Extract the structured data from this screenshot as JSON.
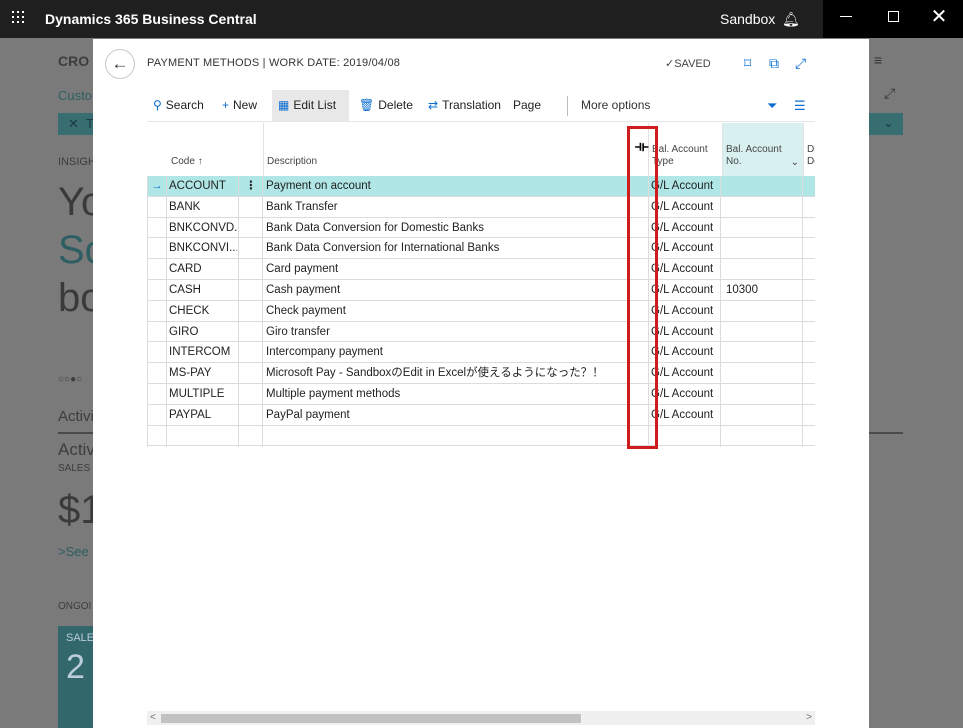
{
  "topbar": {
    "app_title": "Dynamics 365 Business Central",
    "environment": "Sandbox",
    "bell_icon": "bell-icon"
  },
  "background": {
    "company_short": "CRO",
    "customers_short": "Custo",
    "filter_short": "T",
    "insights_short": "INSIGH",
    "big1": "Yo",
    "big2": "Sc",
    "big3": "bo",
    "activities": "Activi",
    "activities2": "Activ",
    "sales_label": "SALES",
    "amount_short": "$1",
    "see_more": "See",
    "ongoing": "ONGOI",
    "card_label": "SALE",
    "card_number": "2"
  },
  "dialog": {
    "title": "PAYMENT METHODS | WORK DATE: 2019/04/08",
    "saved_label": "SAVED"
  },
  "actions": {
    "search": "Search",
    "new": "New",
    "edit_list": "Edit List",
    "delete": "Delete",
    "translation": "Translation",
    "page": "Page",
    "more_options": "More options"
  },
  "grid": {
    "columns": {
      "code": "Code",
      "description": "Description",
      "bal_account_type_1": "Bal. Account",
      "bal_account_type_2": "Type",
      "bal_account_no_1": "Bal. Account",
      "bal_account_no_2": "No.",
      "next_col_1": "Di",
      "next_col_2": "De"
    },
    "rows": [
      {
        "code": "ACCOUNT",
        "description": "Payment on account",
        "type": "G/L Account",
        "no": ""
      },
      {
        "code": "BANK",
        "description": "Bank Transfer",
        "type": "G/L Account",
        "no": ""
      },
      {
        "code": "BNKCONVD...",
        "description": "Bank Data Conversion for Domestic Banks",
        "type": "G/L Account",
        "no": ""
      },
      {
        "code": "BNKCONVI...",
        "description": "Bank Data Conversion for International Banks",
        "type": "G/L Account",
        "no": ""
      },
      {
        "code": "CARD",
        "description": "Card payment",
        "type": "G/L Account",
        "no": ""
      },
      {
        "code": "CASH",
        "description": "Cash payment",
        "type": "G/L Account",
        "no": "10300"
      },
      {
        "code": "CHECK",
        "description": "Check payment",
        "type": "G/L Account",
        "no": ""
      },
      {
        "code": "GIRO",
        "description": "Giro transfer",
        "type": "G/L Account",
        "no": ""
      },
      {
        "code": "INTERCOM",
        "description": "Intercompany payment",
        "type": "G/L Account",
        "no": ""
      },
      {
        "code": "MS-PAY",
        "description": "Microsoft Pay - SandboxのEdit in Excelが使えるようになった？！",
        "type": "G/L Account",
        "no": ""
      },
      {
        "code": "MULTIPLE",
        "description": "Multiple payment methods",
        "type": "G/L Account",
        "no": ""
      },
      {
        "code": "PAYPAL",
        "description": "PayPal payment",
        "type": "G/L Account",
        "no": ""
      },
      {
        "code": "",
        "description": "",
        "type": "",
        "no": ""
      }
    ]
  },
  "colors": {
    "accent": "#0a6ed1",
    "selected_row": "#b0e6e6",
    "highlight_box": "#d01c1c"
  }
}
